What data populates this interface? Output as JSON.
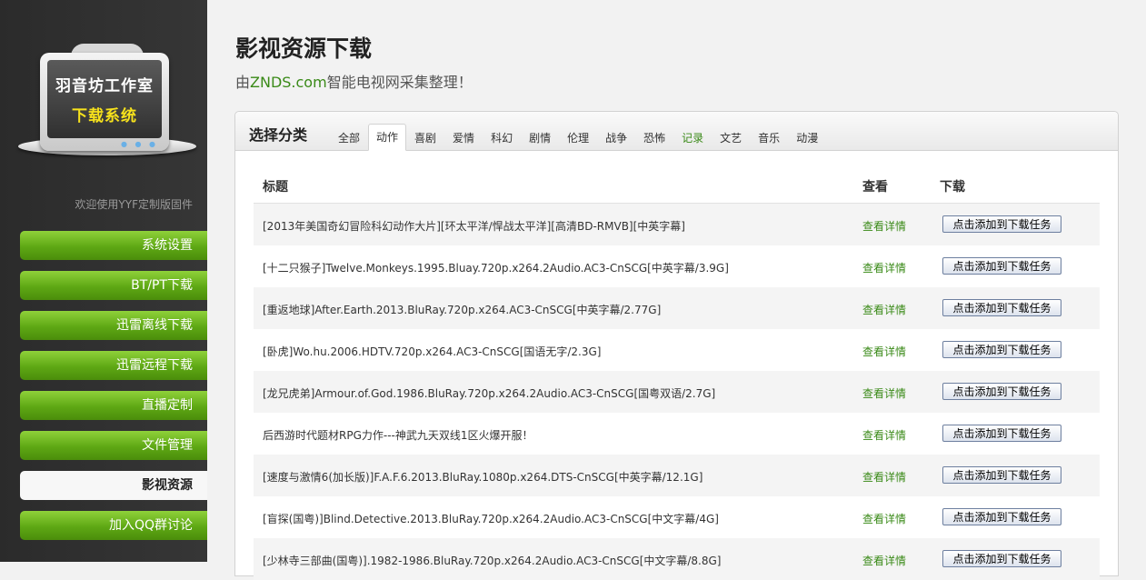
{
  "sidebar": {
    "logo_line1": "羽音坊工作室",
    "logo_line2": "下载系统",
    "welcome": "欢迎使用YYF定制版固件",
    "items": [
      {
        "label": "系统设置"
      },
      {
        "label": "BT/PT下载"
      },
      {
        "label": "迅雷离线下载"
      },
      {
        "label": "迅雷远程下载"
      },
      {
        "label": "直播定制"
      },
      {
        "label": "文件管理"
      },
      {
        "label": "影视资源"
      },
      {
        "label": "加入QQ群讨论"
      }
    ],
    "active_index": 6
  },
  "header": {
    "title": "影视资源下载",
    "subtitle_prefix": "由",
    "subtitle_brand": "ZNDS.com",
    "subtitle_suffix": "智能电视网采集整理！"
  },
  "panel": {
    "title": "选择分类",
    "tabs": [
      "全部",
      "动作",
      "喜剧",
      "爱情",
      "科幻",
      "剧情",
      "伦理",
      "战争",
      "恐怖",
      "记录",
      "文艺",
      "音乐",
      "动漫"
    ],
    "active_tab": 1,
    "columns": {
      "title": "标题",
      "view": "查看",
      "download": "下载"
    },
    "rows": [
      {
        "title": "[2013年美国奇幻冒险科幻动作大片][环太平洋/悍战太平洋][高清BD-RMVB][中英字幕]",
        "view": "查看详情",
        "button": "点击添加到下载任务"
      },
      {
        "title": "[十二只猴子]Twelve.Monkeys.1995.Bluay.720p.x264.2Audio.AC3-CnSCG[中英字幕/3.9G]",
        "view": "查看详情",
        "button": "点击添加到下载任务"
      },
      {
        "title": "[重返地球]After.Earth.2013.BluRay.720p.x264.AC3-CnSCG[中英字幕/2.77G]",
        "view": "查看详情",
        "button": "点击添加到下载任务"
      },
      {
        "title": "[卧虎]Wo.hu.2006.HDTV.720p.x264.AC3-CnSCG[国语无字/2.3G]",
        "view": "查看详情",
        "button": "点击添加到下载任务"
      },
      {
        "title": "[龙兄虎弟]Armour.of.God.1986.BluRay.720p.x264.2Audio.AC3-CnSCG[国粤双语/2.7G]",
        "view": "查看详情",
        "button": "点击添加到下载任务"
      },
      {
        "title": "后西游时代题材RPG力作---神武九天双线1区火爆开服！",
        "view": "查看详情",
        "button": "点击添加到下载任务"
      },
      {
        "title": "[速度与激情6(加长版)]F.A.F.6.2013.BluRay.1080p.x264.DTS-CnSCG[中英字幕/12.1G]",
        "view": "查看详情",
        "button": "点击添加到下载任务"
      },
      {
        "title": "[盲探(国粤)]Blind.Detective.2013.BluRay.720p.x264.2Audio.AC3-CnSCG[中文字幕/4G]",
        "view": "查看详情",
        "button": "点击添加到下载任务"
      },
      {
        "title": "[少林寺三部曲(国粤)].1982-1986.BluRay.720p.x264.2Audio.AC3-CnSCG[中文字幕/8.8G]",
        "view": "查看详情",
        "button": "点击添加到下载任务"
      }
    ]
  }
}
